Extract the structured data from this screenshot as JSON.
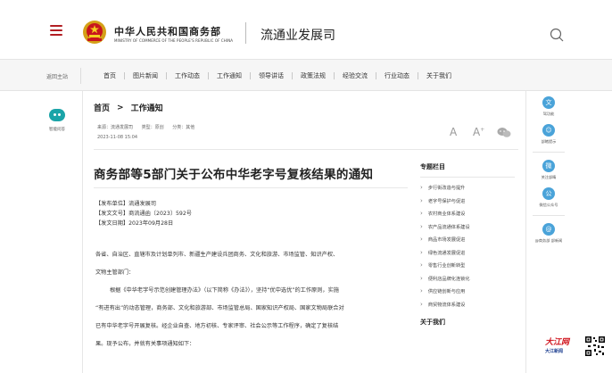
{
  "header": {
    "org_cn": "中华人民共和国商务部",
    "org_en": "MINISTRY OF COMMERCE OF THE PEOPLE'S REPUBLIC OF CHINA",
    "dept": "流通业发展司"
  },
  "nav": {
    "home": "返回主站",
    "items": [
      "首页",
      "图片新闻",
      "工作动态",
      "工作通知",
      "领导讲话",
      "政策法规",
      "经验交流",
      "行业动态",
      "关于我们"
    ]
  },
  "left_tool": {
    "label": "智能问答"
  },
  "breadcrumb": {
    "home": "首页",
    "arrow": ">",
    "current": "工作通知"
  },
  "meta": {
    "source": "来源：流通发展司",
    "type": "类型：原创",
    "category": "分类：其他",
    "datetime": "2023-11-08 15:04",
    "font_a": "A",
    "font_a_plus": "A",
    "font_a_plus_sup": "+"
  },
  "article": {
    "title": "商务部等5部门关于公布中华老字号复核结果的通知",
    "publisher": "【发布单位】流通发展司",
    "doc_no": "【发文文号】商流通函〔2023〕592号",
    "date": "【发文日期】2023年09月28日",
    "para1_l1": "各省、自治区、直辖市及计划单列市、新疆生产建设兵团商务、文化和旅游、市场监管、知识产权、",
    "para1_l2": "文物主管部门：",
    "para2_l1": "根据《中华老字号示范创建管理办法》（以下简称《办法》），坚持“优中选优”的工作原则，实施",
    "para2_l2": "“有进有出”的动态管理，商务部、文化和旅游部、市场监管总局、国家知识产权局、国家文物局联合对",
    "para2_l3": "已有中华老字号开展复核。经企业自查、地方初核、专家评审、社会公示等工作程序，确定了复核结",
    "para2_l4": "果。现予公布，并就有关事项通知如下："
  },
  "sidebar": {
    "topics_title": "专题栏目",
    "topics": [
      "步行街改造与提升",
      "老字号保护与促进",
      "农村商业体系建设",
      "农产品流通体系建设",
      "商品市场发展促进",
      "绿色流通发展促进",
      "零售行业创新转型",
      "便利店品牌化连锁化",
      "供应链创新与应用",
      "商贸物流体系建设"
    ],
    "about_title": "关于我们"
  },
  "right_tools": [
    {
      "icon": "文",
      "label": "驾功能"
    },
    {
      "icon": "☺",
      "label": "部睹提示"
    },
    {
      "icon": "微",
      "label": "关注部睛"
    },
    {
      "icon": "公",
      "label": "微信公众号"
    },
    {
      "icon": "@",
      "label": "@商务部 部新闻"
    }
  ],
  "footer_logo": {
    "line1": "大江网",
    "line2": "大江新闻"
  },
  "colors": {
    "brand_red": "#b21e23",
    "teal": "#1ba4a8",
    "icon_blue": "#4aa3d9"
  }
}
